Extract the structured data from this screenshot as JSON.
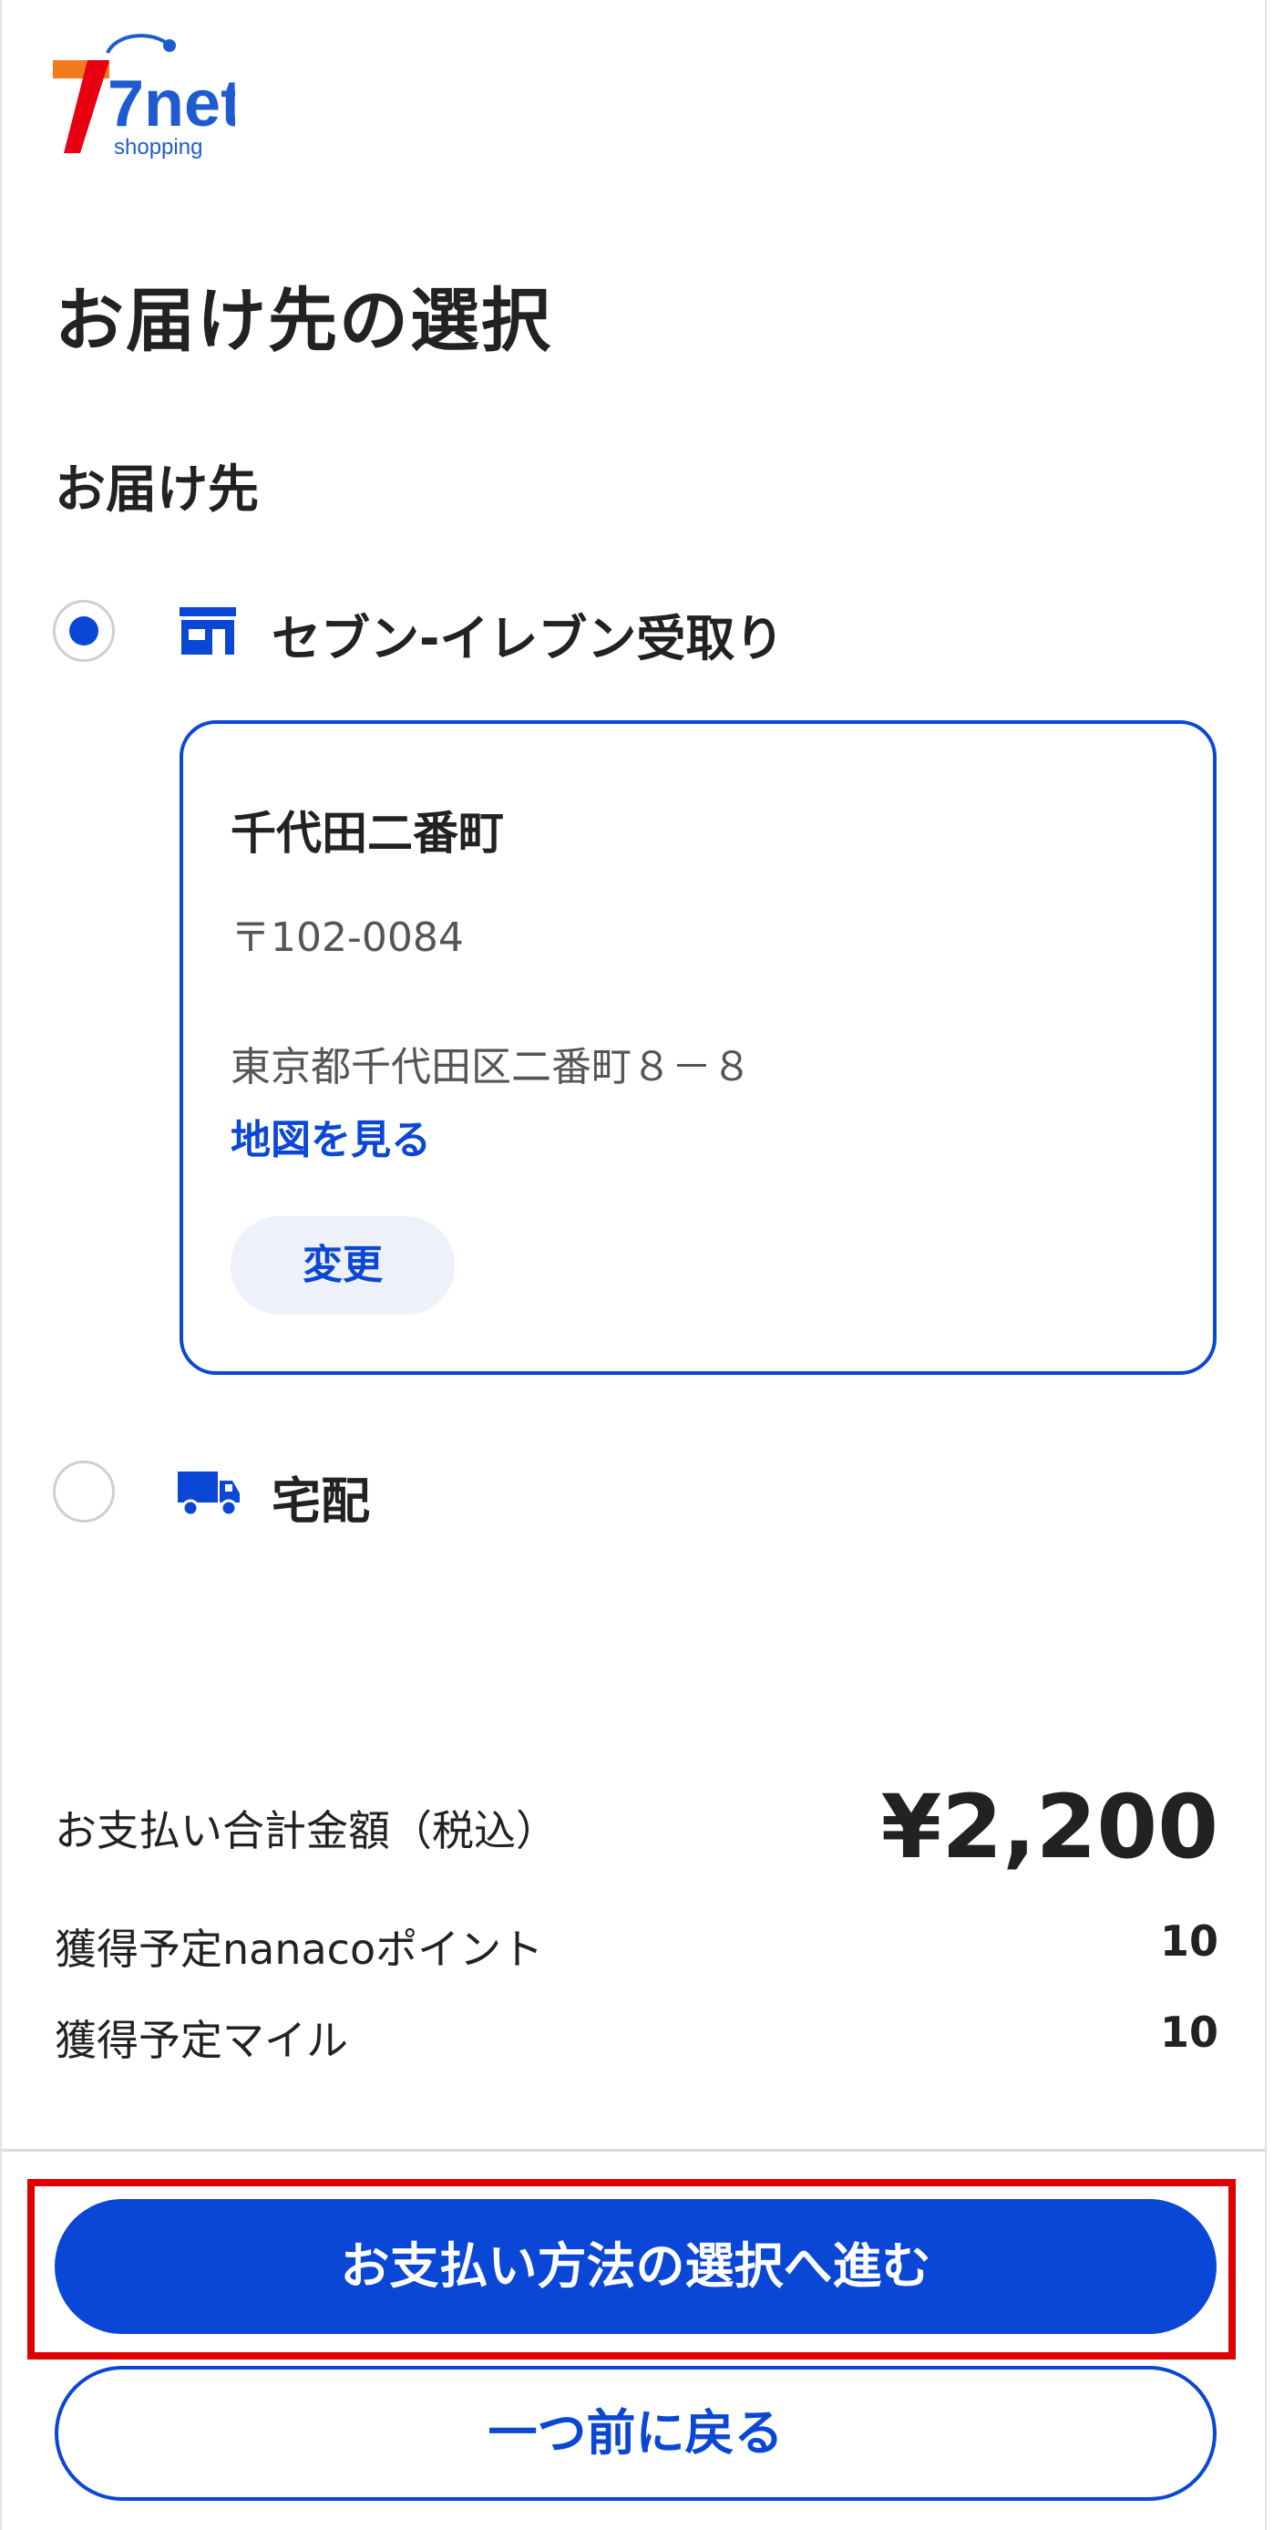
{
  "logo": {
    "brand": "7net",
    "sub": "shopping"
  },
  "page_title": "お届け先の選択",
  "section_title": "お届け先",
  "options": [
    {
      "label": "セブン-イレブン受取り",
      "selected": true,
      "icon": "store-icon"
    },
    {
      "label": "宅配",
      "selected": false,
      "icon": "truck-icon"
    }
  ],
  "store": {
    "name": "千代田二番町",
    "postal": "〒102-0084",
    "address": "東京都千代田区二番町８－８",
    "map_link": "地図を見る",
    "change_label": "変更"
  },
  "summary": {
    "total_label": "お支払い合計金額（税込）",
    "total_value": "¥2,200",
    "nanaco_label": "獲得予定nanacoポイント",
    "nanaco_value": "10",
    "miles_label": "獲得予定マイル",
    "miles_value": "10"
  },
  "buttons": {
    "proceed": "お支払い方法の選択へ進む",
    "back": "一つ前に戻る"
  },
  "colors": {
    "accent": "#0a47d6",
    "highlight": "#e10000"
  }
}
